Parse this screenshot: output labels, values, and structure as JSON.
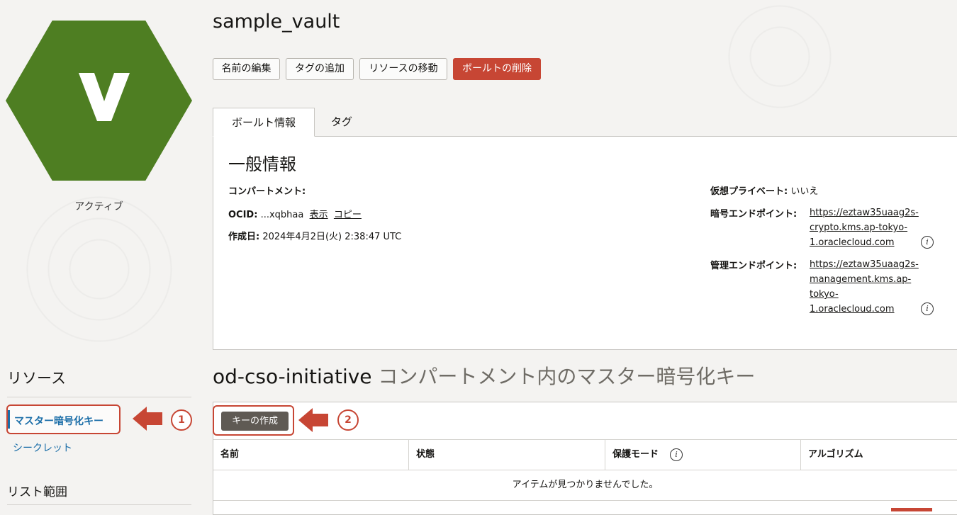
{
  "vault": {
    "icon_letter": "V",
    "status": "アクティブ",
    "name": "sample_vault"
  },
  "colors": {
    "hexagon": "#4e7e22",
    "danger": "#c74634",
    "link": "#1b6ea8",
    "annotation": "#c74634"
  },
  "actions": {
    "edit_name": "名前の編集",
    "add_tags": "タグの追加",
    "move_resource": "リソースの移動",
    "delete_vault": "ボールトの削除"
  },
  "tabs": {
    "vault_info": "ボールト情報",
    "tags": "タグ"
  },
  "general_info": {
    "title": "一般情報",
    "compartment_label": "コンパートメント:",
    "compartment_value": "",
    "ocid_label": "OCID:",
    "ocid_value": "...xqbhaa",
    "show_link": "表示",
    "copy_link": "コピー",
    "created_label": "作成日:",
    "created_value": "2024年4月2日(火) 2:38:47 UTC",
    "virtual_private_label": "仮想プライベート:",
    "virtual_private_value": "いいえ",
    "crypto_endpoint_label": "暗号エンドポイント:",
    "crypto_endpoint_lines": [
      "https://eztaw35uaag2s-",
      "crypto.kms.ap-tokyo-",
      "1.oraclecloud.com"
    ],
    "management_endpoint_label": "管理エンドポイント:",
    "management_endpoint_lines": [
      "https://eztaw35uaag2s-",
      "management.kms.ap-",
      "tokyo-",
      "1.oraclecloud.com"
    ]
  },
  "sidebar": {
    "resources_title": "リソース",
    "items": [
      {
        "label": "マスター暗号化キー",
        "active": true
      },
      {
        "label": "シークレット",
        "active": false
      }
    ],
    "list_scope_title": "リスト範囲"
  },
  "annotations": {
    "step1": "1",
    "step2": "2"
  },
  "keys": {
    "compartment_name": "od-cso-initiative",
    "title_suffix": " コンパートメント内のマスター暗号化キー",
    "create_button": "キーの作成",
    "columns": [
      "名前",
      "状態",
      "保護モード",
      "アルゴリズム"
    ],
    "empty_message": "アイテムが見つかりませんでした。"
  },
  "icons": {
    "info": "info-icon",
    "arrow": "arrow-left-icon"
  }
}
